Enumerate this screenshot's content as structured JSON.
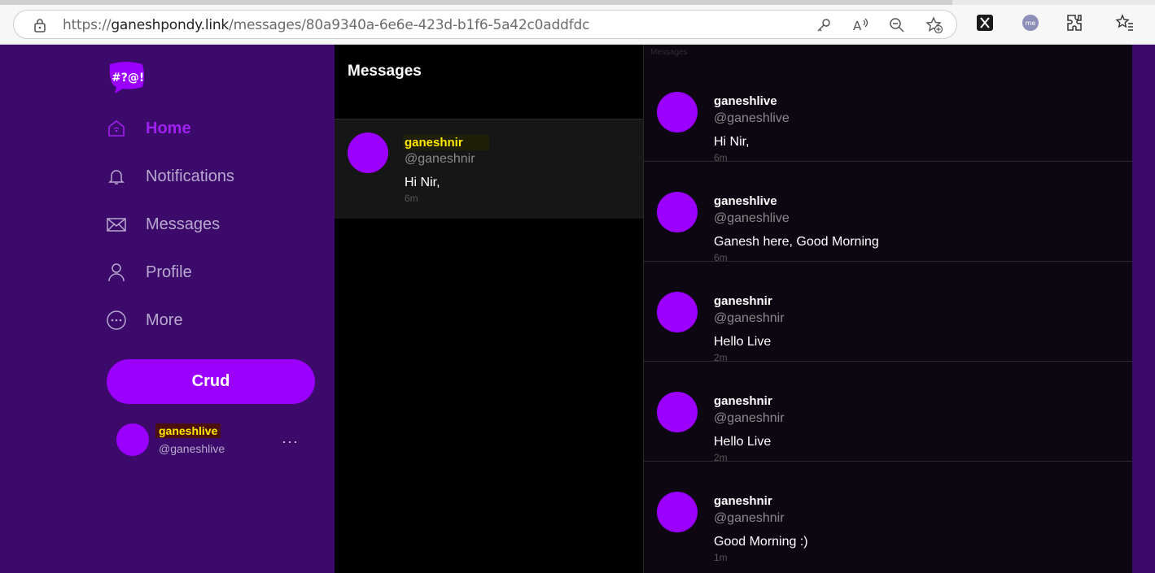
{
  "browser": {
    "url_prefix": "https://",
    "url_host": "ganeshpondy.link",
    "url_path": "/messages/80a9340a-6e6e-423d-b1f6-5a42c0addfdc"
  },
  "app": {
    "logo_text": "#?@!",
    "nav": [
      {
        "label": "Home",
        "icon": "home-icon",
        "active": true
      },
      {
        "label": "Notifications",
        "icon": "bell-icon",
        "active": false
      },
      {
        "label": "Messages",
        "icon": "envelope-icon",
        "active": false
      },
      {
        "label": "Profile",
        "icon": "user-icon",
        "active": false
      },
      {
        "label": "More",
        "icon": "more-circle-icon",
        "active": false
      }
    ],
    "crud_button": "Crud",
    "current_user": {
      "name": "ganeshlive",
      "handle": "@ganeshlive"
    },
    "more_label": "···"
  },
  "messages_panel": {
    "title": "Messages",
    "conversations": [
      {
        "name": "ganeshnir",
        "handle": "@ganeshnir",
        "preview": "Hi Nir,",
        "time": "6m"
      }
    ]
  },
  "thread": {
    "hint": "Messages",
    "messages": [
      {
        "name": "ganeshlive",
        "handle": "@ganeshlive",
        "text": "Hi Nir,",
        "time": "6m"
      },
      {
        "name": "ganeshlive",
        "handle": "@ganeshlive",
        "text": "Ganesh here, Good Morning",
        "time": "6m"
      },
      {
        "name": "ganeshnir",
        "handle": "@ganeshnir",
        "text": "Hello Live",
        "time": "2m"
      },
      {
        "name": "ganeshnir",
        "handle": "@ganeshnir",
        "text": "Hello Live",
        "time": "2m"
      },
      {
        "name": "ganeshnir",
        "handle": "@ganeshnir",
        "text": "Good Morning :)",
        "time": "1m"
      }
    ]
  },
  "colors": {
    "accent": "#9b00ff",
    "sidebar": "#3b0a6b",
    "highlight_text": "#ffea00"
  }
}
